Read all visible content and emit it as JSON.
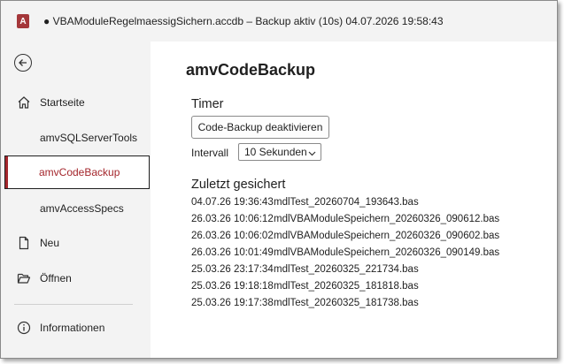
{
  "titlebar": {
    "app_icon_letter": "A",
    "title": "● VBAModuleRegelmaessigSichern.accdb – Backup aktiv (10s) 04.07.2026 19:58:43"
  },
  "sidebar": {
    "items": [
      {
        "label": "Startseite",
        "icon": "home-icon"
      },
      {
        "label": "amvSQLServerTools"
      },
      {
        "label": "amvCodeBackup",
        "active": true
      },
      {
        "label": "amvAccessSpecs"
      },
      {
        "label": "Neu",
        "icon": "new-document-icon"
      },
      {
        "label": "Öffnen",
        "icon": "folder-open-icon"
      },
      {
        "label": "Informationen",
        "icon": "info-icon"
      }
    ]
  },
  "main": {
    "title": "amvCodeBackup",
    "timer": {
      "heading": "Timer",
      "toggle_button": "Code-Backup deaktivieren",
      "interval_label": "Intervall",
      "interval_value": "10 Sekunden"
    },
    "recent": {
      "heading": "Zuletzt gesichert",
      "rows": [
        {
          "time": "04.07.26 19:36:43",
          "file": "mdlTest_20260704_193643.bas"
        },
        {
          "time": "26.03.26 10:06:12",
          "file": "mdlVBAModuleSpeichern_20260326_090612.bas"
        },
        {
          "time": "26.03.26 10:06:02",
          "file": "mdlVBAModuleSpeichern_20260326_090602.bas"
        },
        {
          "time": "26.03.26 10:01:49",
          "file": "mdlVBAModuleSpeichern_20260326_090149.bas"
        },
        {
          "time": "25.03.26 23:17:34",
          "file": "mdlTest_20260325_221734.bas"
        },
        {
          "time": "25.03.26 19:18:18",
          "file": "mdlTest_20260325_181818.bas"
        },
        {
          "time": "25.03.26 19:17:38",
          "file": "mdlTest_20260325_181738.bas"
        }
      ]
    }
  },
  "colors": {
    "accent": "#a4262c",
    "sidebar_bg": "#f3f3f3"
  }
}
